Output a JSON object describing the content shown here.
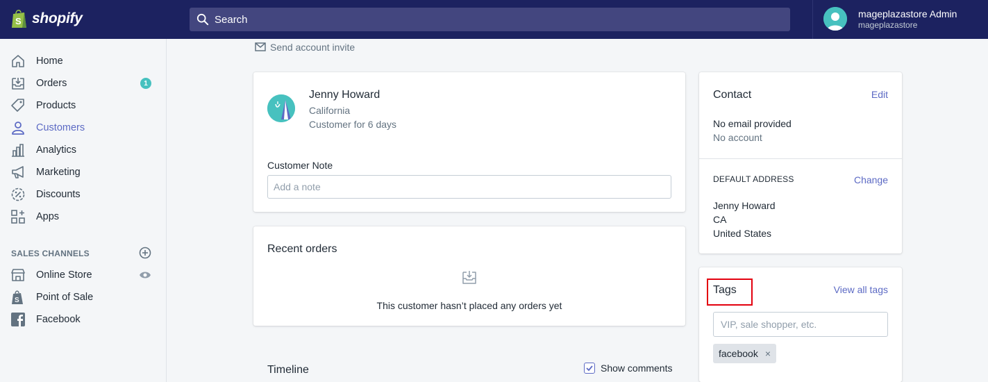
{
  "brand": {
    "name": "shopify"
  },
  "search": {
    "placeholder": "Search"
  },
  "user": {
    "display_name": "mageplazastore Admin",
    "store": "mageplazastore"
  },
  "sidebar": {
    "items": [
      {
        "label": "Home",
        "icon": "home-icon"
      },
      {
        "label": "Orders",
        "icon": "orders-icon",
        "badge": "1"
      },
      {
        "label": "Products",
        "icon": "tag-icon"
      },
      {
        "label": "Customers",
        "icon": "person-icon",
        "active": true
      },
      {
        "label": "Analytics",
        "icon": "bar-chart-icon"
      },
      {
        "label": "Marketing",
        "icon": "megaphone-icon"
      },
      {
        "label": "Discounts",
        "icon": "discount-icon"
      },
      {
        "label": "Apps",
        "icon": "apps-icon"
      }
    ],
    "sales_channels_heading": "SALES CHANNELS",
    "channels": [
      {
        "label": "Online Store",
        "icon": "store-icon"
      },
      {
        "label": "Point of Sale",
        "icon": "shopify-bag-icon"
      },
      {
        "label": "Facebook",
        "icon": "facebook-icon"
      }
    ]
  },
  "main": {
    "send_invite": "Send account invite",
    "profile": {
      "name": "Jenny Howard",
      "location": "California",
      "since": "Customer for 6 days",
      "note_label": "Customer Note",
      "note_placeholder": "Add a note"
    },
    "recent_orders": {
      "title": "Recent orders",
      "empty": "This customer hasn’t placed any orders yet"
    },
    "timeline": {
      "title": "Timeline",
      "show_comments": "Show comments",
      "show_comments_checked": true
    }
  },
  "contact": {
    "title": "Contact",
    "edit": "Edit",
    "email": "No email provided",
    "account": "No account",
    "address_title": "DEFAULT ADDRESS",
    "change": "Change",
    "address_lines": [
      "Jenny Howard",
      "CA",
      "United States"
    ]
  },
  "tags": {
    "title": "Tags",
    "view_all": "View all tags",
    "placeholder": "VIP, sale shopper, etc.",
    "items": [
      "facebook"
    ]
  },
  "colors": {
    "topbar": "#1c2260",
    "accent": "#5c6ac4",
    "teal": "#47c1bf",
    "highlight": "#e3000f"
  }
}
